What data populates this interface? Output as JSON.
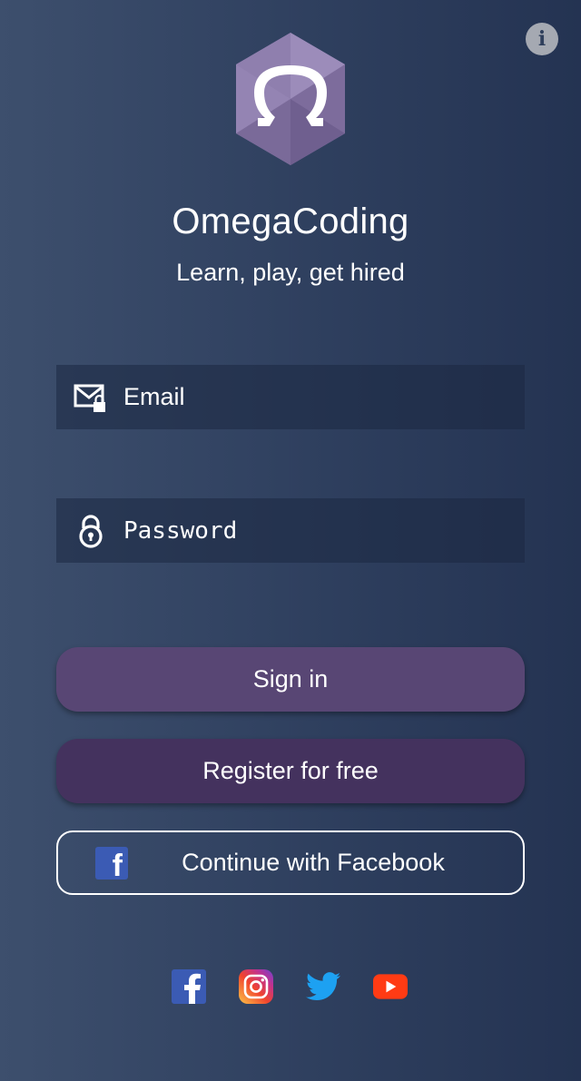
{
  "app": {
    "title": "OmegaCoding",
    "tagline": "Learn, play, get hired"
  },
  "info_button": {
    "icon": "info-icon",
    "glyph": "i"
  },
  "login_form": {
    "email": {
      "placeholder": "Email",
      "value": "",
      "icon": "email-lock-icon"
    },
    "password": {
      "placeholder": "Password",
      "value": "",
      "icon": "padlock-icon"
    }
  },
  "actions": {
    "sign_in_label": "Sign in",
    "register_label": "Register for free",
    "facebook_label": "Continue with Facebook",
    "facebook_icon": "facebook-icon"
  },
  "social_links": [
    {
      "name": "Facebook",
      "icon": "facebook-icon"
    },
    {
      "name": "Instagram",
      "icon": "instagram-icon"
    },
    {
      "name": "Twitter",
      "icon": "twitter-icon"
    },
    {
      "name": "YouTube",
      "icon": "youtube-icon"
    }
  ],
  "colors": {
    "background_left": "#3d4f6d",
    "background_right": "#243352",
    "sign_in_button": "#584674",
    "register_button": "#44325e",
    "logo_purple": "#8b7aaa",
    "facebook_blue": "#3b5bb4",
    "twitter_blue": "#1da1f2",
    "youtube_red": "#ff3b14"
  }
}
